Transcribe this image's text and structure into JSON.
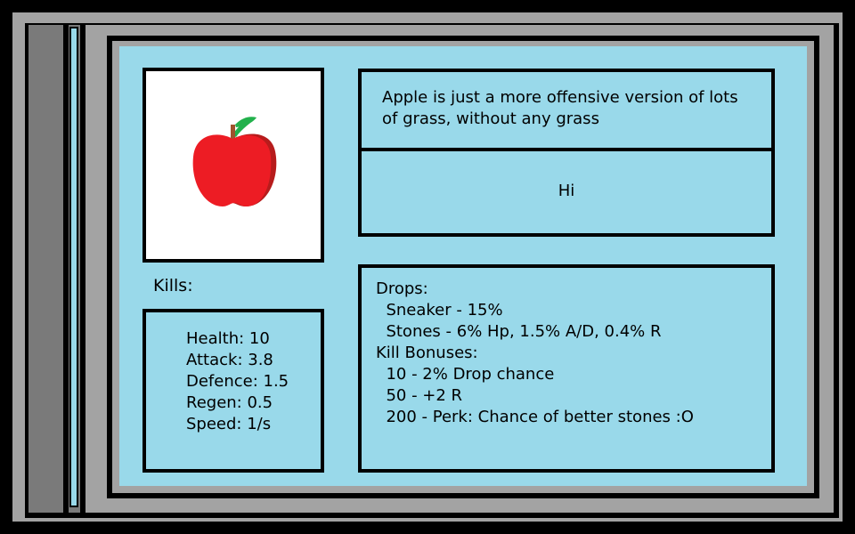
{
  "enemy": {
    "name": "Apple",
    "portrait_icon": "apple-icon",
    "kills_label": "Kills:",
    "description": "Apple is just a more offensive version of lots of grass, without any grass",
    "message": "Hi"
  },
  "stats": [
    "Health: 10",
    "Attack: 3.8",
    "Defence: 1.5",
    "Regen: 0.5",
    "Speed: 1/s"
  ],
  "drops": {
    "lines": [
      "Drops:",
      "  Sneaker - 15%",
      "  Stones - 6% Hp, 1.5% A/D, 0.4% R",
      "Kill Bonuses:",
      "  10 - 2% Drop chance",
      "  50 - +2 R",
      "  200 - Perk: Chance of better stones :O"
    ]
  },
  "colors": {
    "panel_blue": "#99d9ea",
    "frame_grey": "#a3a3a3",
    "sidebar_grey": "#7a7a7a",
    "apple_red": "#ed1c24",
    "apple_shadow": "#b71c1c",
    "leaf_green": "#22b14c"
  }
}
